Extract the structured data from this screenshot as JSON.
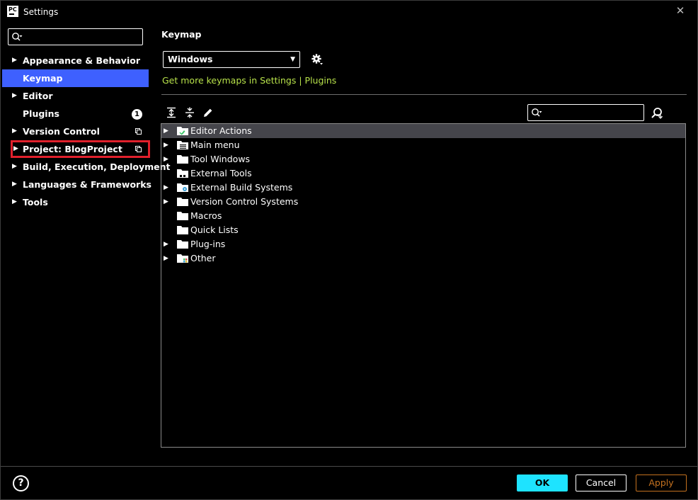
{
  "window": {
    "app_icon_text": "PC",
    "title": "Settings",
    "close_glyph": "✕"
  },
  "sidebar": {
    "search_placeholder": "",
    "items": [
      {
        "label": "Appearance & Behavior",
        "has_children": true
      },
      {
        "label": "Keymap",
        "has_children": false,
        "selected": true
      },
      {
        "label": "Editor",
        "has_children": true
      },
      {
        "label": "Plugins",
        "has_children": false,
        "badge": "1"
      },
      {
        "label": "Version Control",
        "has_children": true,
        "project_icon": "copy-icon"
      },
      {
        "label": "Project: BlogProject",
        "has_children": true,
        "project_icon": "copy-icon",
        "highlighted": true
      },
      {
        "label": "Build, Execution, Deployment",
        "has_children": true
      },
      {
        "label": "Languages & Frameworks",
        "has_children": true
      },
      {
        "label": "Tools",
        "has_children": true
      }
    ]
  },
  "keymap": {
    "section_title": "Keymap",
    "selected_keymap": "Windows",
    "plugins_link": "Get more keymaps in Settings | Plugins",
    "tree_search_placeholder": "",
    "tree": [
      {
        "label": "Editor Actions",
        "expandable": true,
        "selected": true,
        "icon": "editor-actions-folder-icon"
      },
      {
        "label": "Main menu",
        "expandable": true,
        "icon": "main-menu-folder-icon"
      },
      {
        "label": "Tool Windows",
        "expandable": true,
        "icon": "folder-icon"
      },
      {
        "label": "External Tools",
        "expandable": false,
        "icon": "external-tools-folder-icon"
      },
      {
        "label": "External Build Systems",
        "expandable": true,
        "icon": "build-systems-folder-icon"
      },
      {
        "label": "Version Control Systems",
        "expandable": true,
        "icon": "folder-icon"
      },
      {
        "label": "Macros",
        "expandable": false,
        "icon": "folder-icon"
      },
      {
        "label": "Quick Lists",
        "expandable": false,
        "icon": "folder-icon"
      },
      {
        "label": "Plug-ins",
        "expandable": true,
        "icon": "folder-icon"
      },
      {
        "label": "Other",
        "expandable": true,
        "icon": "other-folder-icon"
      }
    ]
  },
  "footer": {
    "help_label": "?",
    "ok_label": "OK",
    "cancel_label": "Cancel",
    "apply_label": "Apply"
  },
  "colors": {
    "selection": "#3e60ff",
    "highlight_box": "#e0202c",
    "link": "#b7e14a",
    "ok_button": "#1ee3ff",
    "apply_button": "#c3711f",
    "tree_selection": "#45454b"
  }
}
